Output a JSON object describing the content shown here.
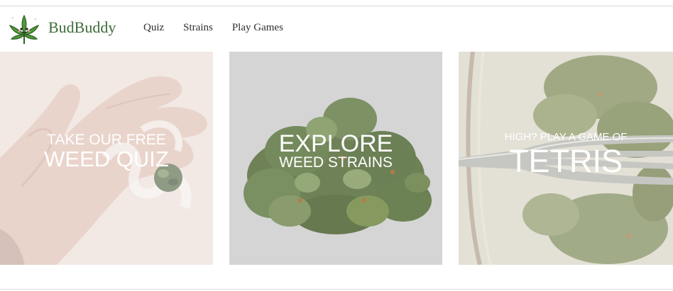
{
  "brand": {
    "name": "BudBuddy",
    "logo_icon": "cannabis-leaf-icon",
    "color": "#3f6b3a"
  },
  "nav": {
    "items": [
      {
        "label": "Quiz"
      },
      {
        "label": "Strains"
      },
      {
        "label": "Play Games"
      }
    ]
  },
  "tiles": [
    {
      "small": "Take our free",
      "big": "Weed Quiz",
      "image": "hand-holding-joint-photo"
    },
    {
      "big": "Explore",
      "small": "Weed Strains",
      "image": "cannabis-buds-pile-photo"
    },
    {
      "small": "High? Play a game of",
      "big": "Tetris",
      "image": "fork-in-jar-of-buds-photo"
    }
  ]
}
